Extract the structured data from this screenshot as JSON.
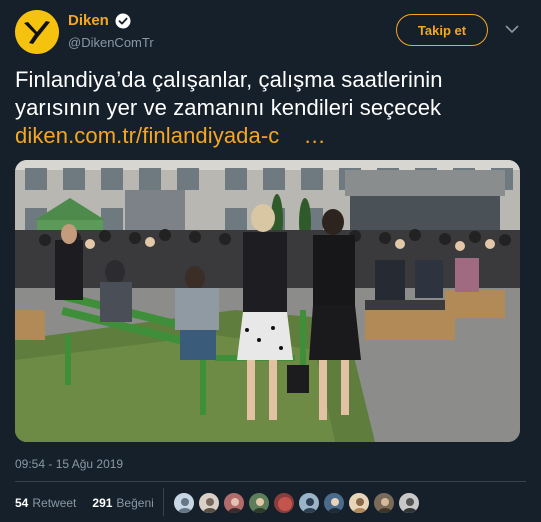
{
  "author": {
    "display_name": "Diken",
    "handle": "@DikenComTr",
    "avatar_icon": "diken-logo-icon",
    "verified_icon": "verified-badge-icon"
  },
  "follow_button": {
    "label": "Takip et"
  },
  "menu_icon": "chevron-down-icon",
  "tweet": {
    "text_line1": "Finlandiya’da çalışanlar, çalışma saatlerinin",
    "text_line2": "yarısının yer ve zamanını kendileri seçecek",
    "link_text": "diken.com.tr/finlandiyada-c",
    "link_ellipsis": "…"
  },
  "photo": {
    "icon": "photo-image"
  },
  "timestamp": "09:54 - 15 Ağu 2019",
  "stats": {
    "retweets_count": "54",
    "retweets_label": "Retweet",
    "likes_count": "291",
    "likes_label": "Beğeni"
  },
  "likers": [
    "liker-1",
    "liker-2",
    "liker-3",
    "liker-4",
    "liker-5",
    "liker-6",
    "liker-7",
    "liker-8",
    "liker-9",
    "liker-10"
  ],
  "colors": {
    "background": "#15202b",
    "accent": "#f5a623",
    "muted": "#8899a6",
    "divider": "#38444d"
  }
}
